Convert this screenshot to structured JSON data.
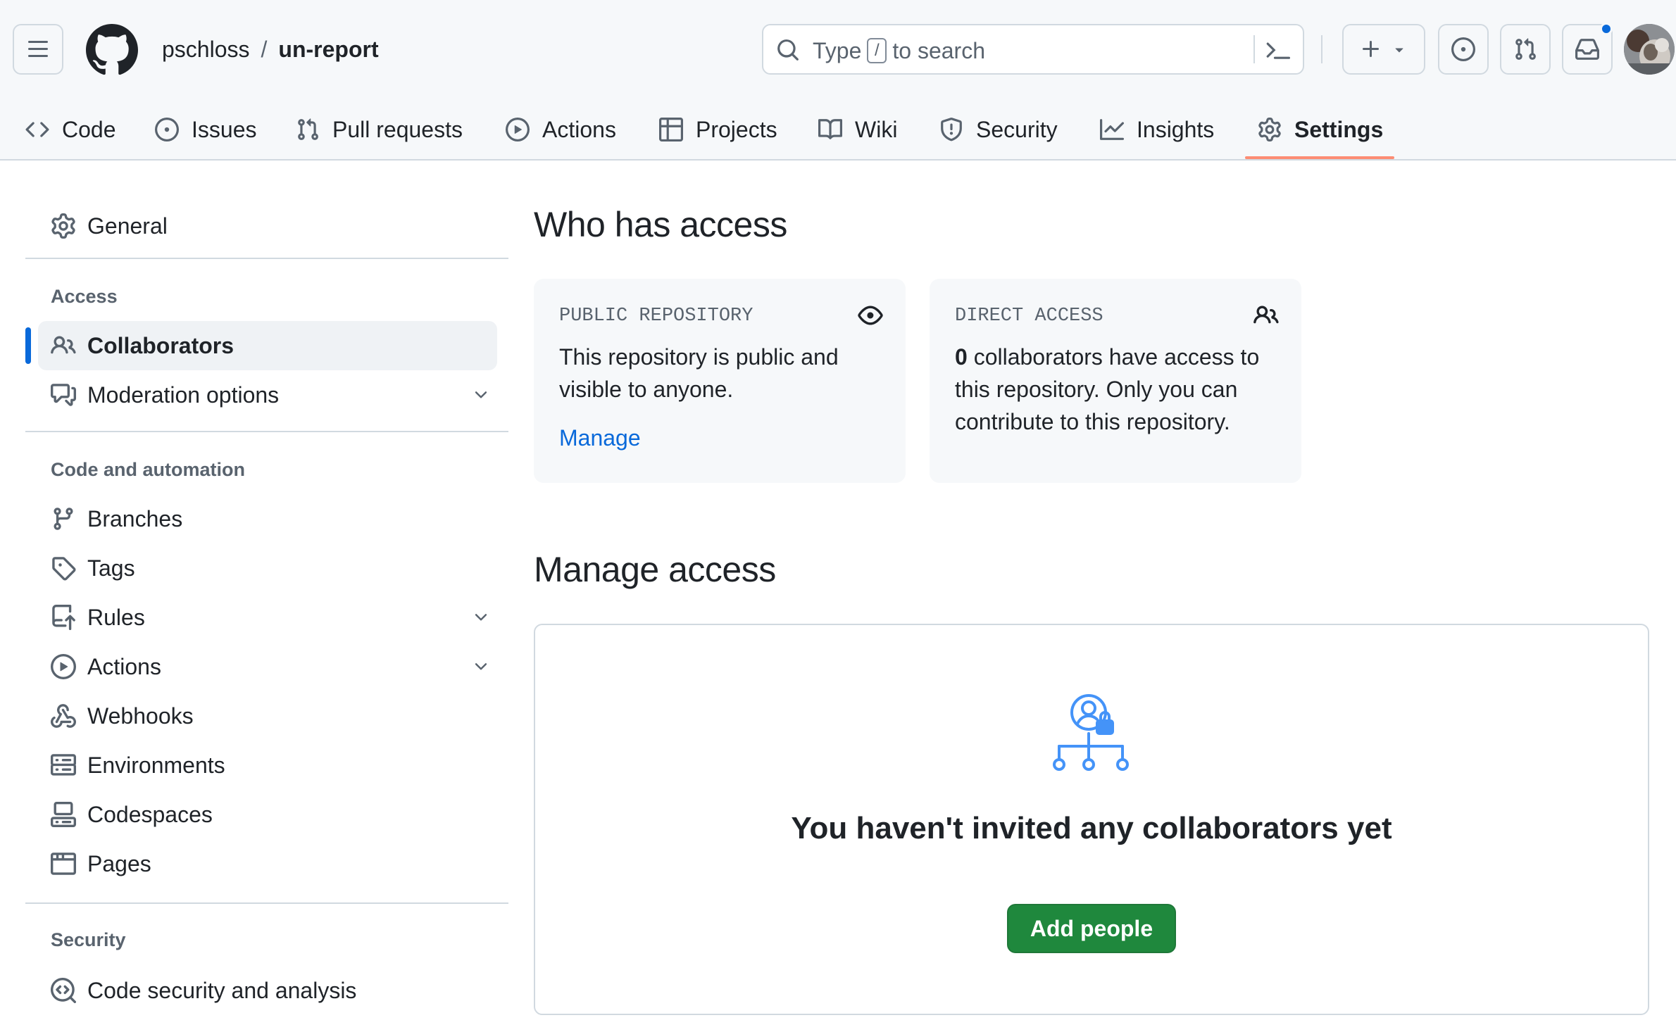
{
  "header": {
    "owner": "pschloss",
    "separator": "/",
    "repo": "un-report",
    "search": {
      "prefix": "Type",
      "key": "/",
      "suffix": "to search"
    },
    "icons": {
      "menu": "hamburger-icon",
      "logo": "github-mark-icon",
      "search": "search-icon",
      "command": "command-palette-icon",
      "create": "plus-icon",
      "issues": "issue-opened-icon",
      "pulls": "git-pull-request-icon",
      "inbox": "inbox-icon"
    },
    "notification_indicator": true,
    "accent_color": "#0969da"
  },
  "repo_nav": {
    "tabs": [
      {
        "label": "Code",
        "icon": "code-icon"
      },
      {
        "label": "Issues",
        "icon": "issue-opened-icon"
      },
      {
        "label": "Pull requests",
        "icon": "git-pull-request-icon"
      },
      {
        "label": "Actions",
        "icon": "play-icon"
      },
      {
        "label": "Projects",
        "icon": "table-icon"
      },
      {
        "label": "Wiki",
        "icon": "book-icon"
      },
      {
        "label": "Security",
        "icon": "shield-icon"
      },
      {
        "label": "Insights",
        "icon": "graph-icon"
      },
      {
        "label": "Settings",
        "icon": "gear-icon"
      }
    ],
    "selected": "Settings",
    "underline_color": "#fd8c73"
  },
  "sidebar": {
    "general": "General",
    "sections": [
      {
        "heading": "Access",
        "items": [
          {
            "label": "Collaborators",
            "icon": "people-icon",
            "active": true
          },
          {
            "label": "Moderation options",
            "icon": "comment-discussion-icon",
            "expandable": true
          }
        ]
      },
      {
        "heading": "Code and automation",
        "items": [
          {
            "label": "Branches",
            "icon": "git-branch-icon"
          },
          {
            "label": "Tags",
            "icon": "tag-icon"
          },
          {
            "label": "Rules",
            "icon": "repo-push-icon",
            "expandable": true
          },
          {
            "label": "Actions",
            "icon": "play-icon",
            "expandable": true
          },
          {
            "label": "Webhooks",
            "icon": "webhook-icon"
          },
          {
            "label": "Environments",
            "icon": "server-icon"
          },
          {
            "label": "Codespaces",
            "icon": "codespaces-icon"
          },
          {
            "label": "Pages",
            "icon": "browser-icon"
          }
        ]
      },
      {
        "heading": "Security",
        "items": [
          {
            "label": "Code security and analysis",
            "icon": "codescan-icon"
          }
        ]
      }
    ]
  },
  "main": {
    "who_has_access": {
      "title": "Who has access",
      "public_card": {
        "label": "PUBLIC REPOSITORY",
        "icon": "eye-icon",
        "text": "This repository is public and visible to anyone.",
        "link": "Manage"
      },
      "direct_card": {
        "label": "DIRECT ACCESS",
        "icon": "people-icon",
        "count": "0",
        "text": "collaborators have access to this repository. Only you can contribute to this repository."
      }
    },
    "manage_access": {
      "title": "Manage access",
      "empty_icon": "people-lock-network-icon",
      "empty_title": "You haven't invited any collaborators yet",
      "button": "Add people",
      "button_color": "#1f883d"
    }
  }
}
